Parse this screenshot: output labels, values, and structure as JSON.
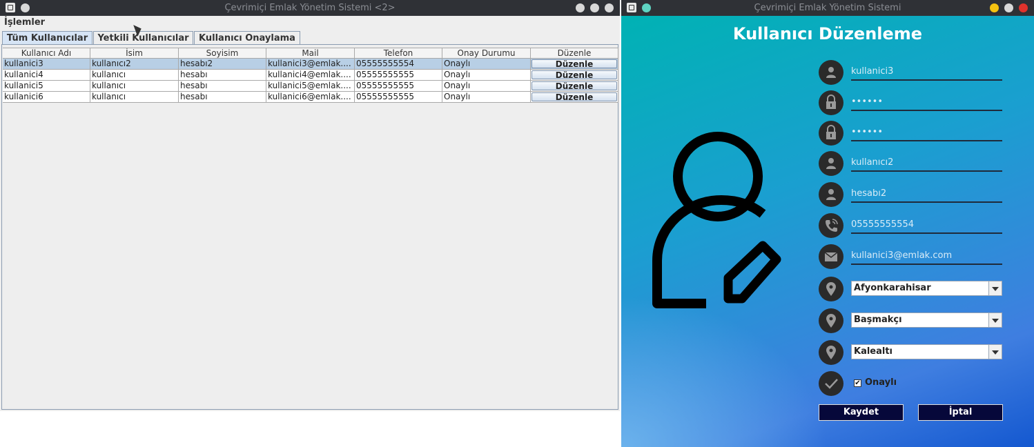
{
  "left_window": {
    "title": "Çevrimiçi Emlak Yönetim Sistemi <2>",
    "menu": {
      "islemler": "İşlemler"
    },
    "tabs": [
      "Tüm Kullanıcılar",
      "Yetkili Kullanıcılar",
      "Kullanıcı Onaylama"
    ],
    "table": {
      "columns": [
        "Kullanıcı Adı",
        "İsim",
        "Soyisim",
        "Mail",
        "Telefon",
        "Onay Durumu",
        "Düzenle"
      ],
      "rows": [
        [
          "kullanici3",
          "kullanıcı2",
          "hesabı2",
          "kullanici3@emlak....",
          "05555555554",
          "Onaylı",
          "Düzenle"
        ],
        [
          "kullanici4",
          "kullanıcı",
          "hesabı",
          "kullanici4@emlak....",
          "05555555555",
          "Onaylı",
          "Düzenle"
        ],
        [
          "kullanici5",
          "kullanıcı",
          "hesabı",
          "kullanici5@emlak....",
          "05555555555",
          "Onaylı",
          "Düzenle"
        ],
        [
          "kullanici6",
          "kullanıcı",
          "hesabı",
          "kullanici6@emlak....",
          "05555555555",
          "Onaylı",
          "Düzenle"
        ]
      ]
    }
  },
  "right_window": {
    "title": "Çevrimiçi Emlak Yönetim Sistemi",
    "heading": "Kullanıcı Düzenleme",
    "fields": {
      "username": "kullanici3",
      "password": "••••••",
      "password_confirm": "••••••",
      "first_name": "kullanıcı2",
      "last_name": "hesabı2",
      "phone": "05555555554",
      "email": "kullanici3@emlak.com"
    },
    "selects": {
      "city": "Afyonkarahisar",
      "district": "Başmakçı",
      "neighborhood": "Kalealtı"
    },
    "approved_label": "Onaylı",
    "approved_checked": true,
    "buttons": {
      "save": "Kaydet",
      "cancel": "İptal"
    }
  },
  "icons": [
    "app-icon",
    "user-icon",
    "lock-icon",
    "phone-icon",
    "mail-icon",
    "location-pin-icon",
    "check-icon",
    "user-edit-icon"
  ],
  "colors": {
    "titlebar": "#2f3136",
    "selected_row": "#b8cfe5",
    "button_dark": "#06083a",
    "gradient_top": "#00b2b4",
    "gradient_bottom": "#1458d0"
  }
}
